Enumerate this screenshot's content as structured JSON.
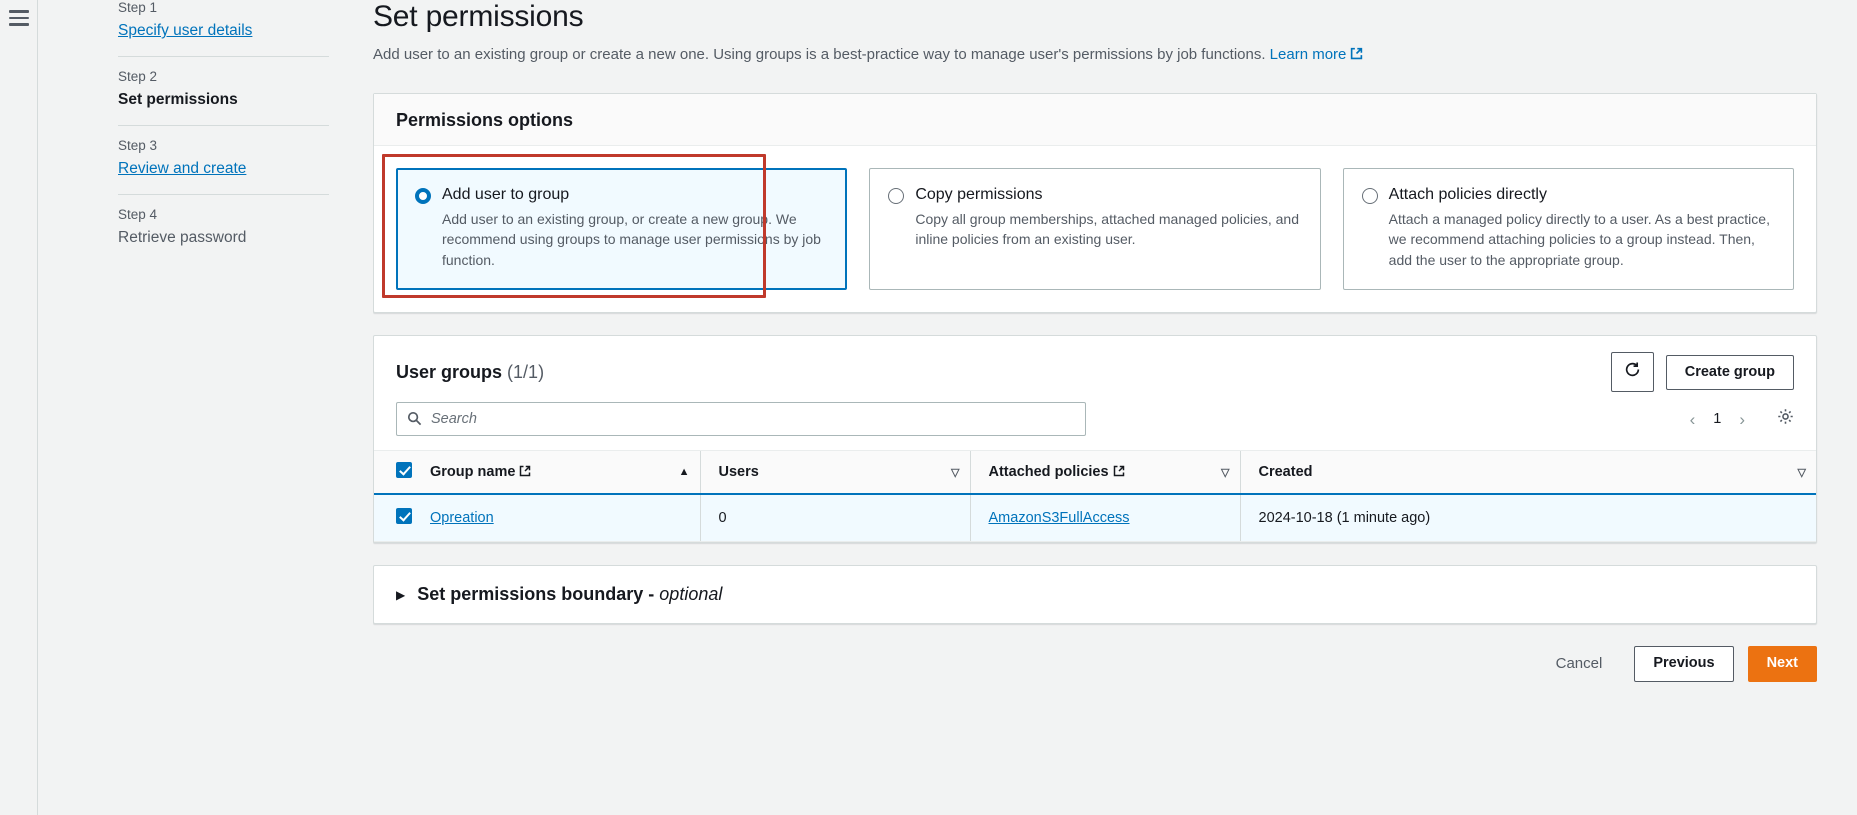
{
  "colors": {
    "accent": "#0073bb",
    "primary_button": "#ec7211",
    "highlight": "#c0392b",
    "selected_row": "#f1faff",
    "page_bg": "#f2f3f3"
  },
  "nav": {
    "menu_icon": "hamburger-menu-icon"
  },
  "sidebar": {
    "steps": [
      {
        "number": "Step 1",
        "label": "Specify user details",
        "state": "link"
      },
      {
        "number": "Step 2",
        "label": "Set permissions",
        "state": "current"
      },
      {
        "number": "Step 3",
        "label": "Review and create",
        "state": "link"
      },
      {
        "number": "Step 4",
        "label": "Retrieve password",
        "state": "muted"
      }
    ]
  },
  "page": {
    "title": "Set permissions",
    "description": "Add user to an existing group or create a new one. Using groups is a best-practice way to manage user's permissions by job functions.",
    "learn_more": "Learn more"
  },
  "permissions_options": {
    "title": "Permissions options",
    "options": [
      {
        "label": "Add user to group",
        "description": "Add user to an existing group, or create a new group. We recommend using groups to manage user permissions by job function.",
        "selected": true,
        "highlighted": true
      },
      {
        "label": "Copy permissions",
        "description": "Copy all group memberships, attached managed policies, and inline policies from an existing user.",
        "selected": false,
        "highlighted": false
      },
      {
        "label": "Attach policies directly",
        "description": "Attach a managed policy directly to a user. As a best practice, we recommend attaching policies to a group instead. Then, add the user to the appropriate group.",
        "selected": false,
        "highlighted": false
      }
    ]
  },
  "user_groups": {
    "title": "User groups",
    "count": "(1/1)",
    "refresh_icon": "refresh-icon",
    "create_group_label": "Create group",
    "search": {
      "placeholder": "Search",
      "value": "",
      "icon": "search-icon"
    },
    "pagination": {
      "prev_icon": "chevron-left-icon",
      "page": "1",
      "next_icon": "chevron-right-icon",
      "settings_icon": "gear-icon"
    },
    "columns": [
      {
        "label": "Group name",
        "external": true,
        "sort": "asc"
      },
      {
        "label": "Users",
        "external": false,
        "sort": "none"
      },
      {
        "label": "Attached policies",
        "external": true,
        "sort": "none"
      },
      {
        "label": "Created",
        "external": false,
        "sort": "none"
      }
    ],
    "header_checkbox_checked": true,
    "rows": [
      {
        "selected": true,
        "group_name": "Opreation",
        "users": "0",
        "attached_policies": "AmazonS3FullAccess",
        "created": "2024-10-18 (1 minute ago)"
      }
    ]
  },
  "permissions_boundary": {
    "caret_icon": "caret-right-icon",
    "title": "Set permissions boundary - ",
    "optional": "optional"
  },
  "footer": {
    "cancel_label": "Cancel",
    "previous_label": "Previous",
    "next_label": "Next"
  }
}
